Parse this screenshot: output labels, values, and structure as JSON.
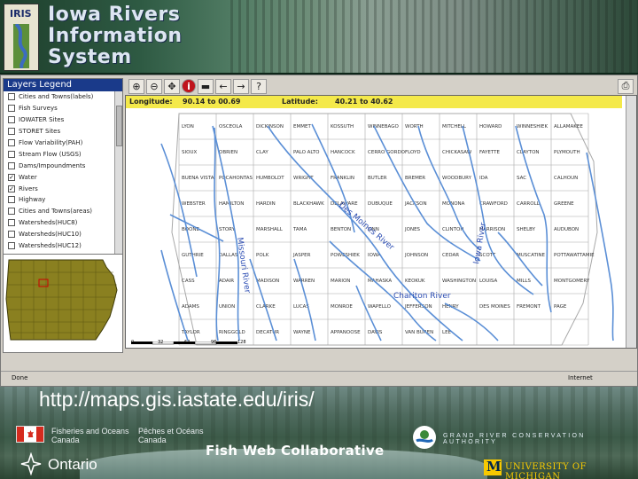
{
  "banner": {
    "logo_text": "IRIS",
    "title_lines": [
      "Iowa Rivers",
      "Information",
      "System"
    ]
  },
  "legend": {
    "title": "Layers Legend",
    "layers": [
      {
        "label": "Cities and Towns(labels)",
        "checked": false
      },
      {
        "label": "Fish Surveys",
        "checked": false
      },
      {
        "label": "IOWATER Sites",
        "checked": false
      },
      {
        "label": "STORET Sites",
        "checked": false
      },
      {
        "label": "Flow Variability(PAH)",
        "checked": false
      },
      {
        "label": "Stream Flow (USGS)",
        "checked": false
      },
      {
        "label": "Dams/Impoundments",
        "checked": false
      },
      {
        "label": "Water",
        "checked": true
      },
      {
        "label": "Rivers",
        "checked": true
      },
      {
        "label": "Highway",
        "checked": false
      },
      {
        "label": "Cities and Towns(areas)",
        "checked": false
      },
      {
        "label": "Watersheds(HUC8)",
        "checked": false
      },
      {
        "label": "Watersheds(HUC10)",
        "checked": false
      },
      {
        "label": "Watersheds(HUC12)",
        "checked": false
      }
    ],
    "check_mark": "✓"
  },
  "toolbar": {
    "tools": [
      {
        "name": "zoom-in-icon",
        "glyph": "⊕"
      },
      {
        "name": "zoom-out-icon",
        "glyph": "⊖"
      },
      {
        "name": "pan-icon",
        "glyph": "✥"
      },
      {
        "name": "info-icon",
        "glyph": "i"
      },
      {
        "name": "measure-icon",
        "glyph": "▬"
      },
      {
        "name": "back-arrow-icon",
        "glyph": "←"
      },
      {
        "name": "forward-arrow-icon",
        "glyph": "→"
      },
      {
        "name": "help-icon",
        "glyph": "?"
      }
    ],
    "print_glyph": "⎙"
  },
  "map": {
    "longitude_label": "Longitude:",
    "longitude_value": "90.14 to 00.69",
    "latitude_label": "Latitude:",
    "latitude_value": "40.21 to 40.62",
    "scale_labels": [
      "0",
      "32",
      "64",
      "96",
      "128"
    ],
    "counties": [
      "LYON",
      "OSCEOLA",
      "DICKINSON",
      "EMMET",
      "KOSSUTH",
      "WINNEBAGO",
      "WORTH",
      "MITCHELL",
      "HOWARD",
      "WINNESHIEK",
      "ALLAMAKEE",
      "SIOUX",
      "OBRIEN",
      "CLAY",
      "PALO ALTO",
      "HANCOCK",
      "CERRO GORDO",
      "FLOYD",
      "CHICKASAW",
      "FAYETTE",
      "CLAYTON",
      "PLYMOUTH",
      "BUENA VISTA",
      "POCAHONTAS",
      "HUMBOLDT",
      "WRIGHT",
      "FRANKLIN",
      "BUTLER",
      "BREMER",
      "WOODBURY",
      "IDA",
      "SAC",
      "CALHOUN",
      "WEBSTER",
      "HAMILTON",
      "HARDIN",
      "BLACKHAWK",
      "DELAWARE",
      "DUBUQUE",
      "JACKSON",
      "MONONA",
      "CRAWFORD",
      "CARROLL",
      "GREENE",
      "BOONE",
      "STORY",
      "MARSHALL",
      "TAMA",
      "BENTON",
      "LINN",
      "JONES",
      "CLINTON",
      "HARRISON",
      "SHELBY",
      "AUDUBON",
      "GUTHRIE",
      "DALLAS",
      "POLK",
      "JASPER",
      "POWESHIEK",
      "IOWA",
      "JOHNSON",
      "CEDAR",
      "SCOTT",
      "MUSCATINE",
      "POTTAWATTAMIE",
      "CASS",
      "ADAIR",
      "MADISON",
      "WARREN",
      "MARION",
      "MAHASKA",
      "KEOKUK",
      "WASHINGTON",
      "LOUISA",
      "MILLS",
      "MONTGOMERY",
      "ADAMS",
      "UNION",
      "CLARKE",
      "LUCAS",
      "MONROE",
      "WAPELLO",
      "JEFFERSON",
      "HENRY",
      "DES MOINES",
      "FREMONT",
      "PAGE",
      "TAYLOR",
      "RINGGOLD",
      "DECATUR",
      "WAYNE",
      "APPANOOSE",
      "DAVIS",
      "VAN BUREN",
      "LEE"
    ],
    "river_labels": [
      "Des Moines River",
      "Iowa River",
      "Missouri River",
      "Chariton River"
    ]
  },
  "status": {
    "left": "Done",
    "right": "Internet"
  },
  "footer": {
    "url": "http://maps.gis.iastate.edu/iris/",
    "dfo_en": [
      "Fisheries and Oceans",
      "Canada"
    ],
    "dfo_fr": [
      "Pêches et Océans",
      "Canada"
    ],
    "collab": "Fish Web Collaborative",
    "ontario": "Ontario",
    "grca": "GRAND RIVER CONSERVATION AUTHORITY",
    "um_letter": "M",
    "um_text": "UNIVERSITY OF MICHIGAN"
  },
  "colors": {
    "legend_header": "#1a3a8a",
    "coord_bar": "#f4e94a",
    "river": "#5b8fd6",
    "county_border": "#a8a8a8",
    "overview_fill": "#8a8020",
    "um_maize": "#f7c900",
    "um_blue": "#00274c"
  }
}
